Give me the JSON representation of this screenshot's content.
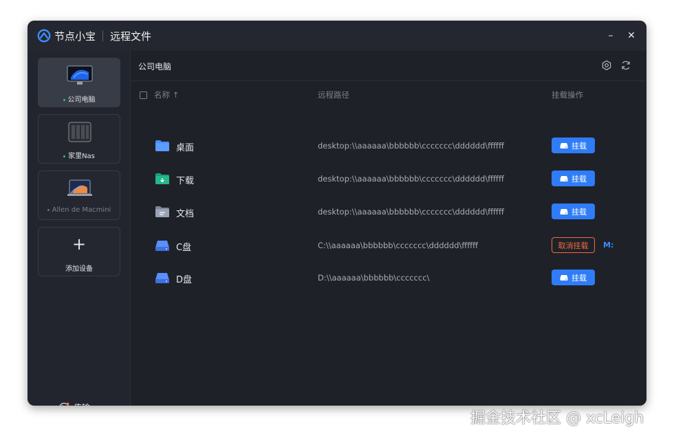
{
  "app": {
    "name": "节点小宝",
    "page": "远程文件"
  },
  "window_controls": {
    "minimize_glyph": "–",
    "close_glyph": "✕"
  },
  "sidebar": {
    "devices": [
      {
        "label": "公司电脑",
        "online": true,
        "active": true
      },
      {
        "label": "家里Nas",
        "online": true,
        "active": false
      },
      {
        "label": "Allen de Macmini",
        "online": false,
        "active": false
      }
    ],
    "add_device": {
      "plus": "+",
      "label": "添加设备"
    },
    "transfer": {
      "label": "传输"
    }
  },
  "main": {
    "title": "公司电脑",
    "columns": {
      "name": "名称 ↑",
      "path": "远程路径",
      "action": "挂载操作"
    },
    "rows": [
      {
        "name": "桌面",
        "icon": "folder-icon",
        "path": "desktop:\\\\aaaaaa\\bbbbbb\\ccccccc\\dddddd\\ffffff",
        "mounted": false,
        "action": "挂载"
      },
      {
        "name": "下载",
        "icon": "download-folder-icon",
        "path": "desktop:\\\\aaaaaa\\bbbbbb\\ccccccc\\dddddd\\ffffff",
        "mounted": false,
        "action": "挂载"
      },
      {
        "name": "文档",
        "icon": "document-folder-icon",
        "path": "desktop:\\\\aaaaaa\\bbbbbb\\ccccccc\\dddddd\\ffffff",
        "mounted": false,
        "action": "挂载"
      },
      {
        "name": "C盘",
        "icon": "drive-icon",
        "path": "C:\\\\aaaaaa\\bbbbbb\\ccccccc\\dddddd\\ffffff",
        "mounted": true,
        "action": "取消挂载",
        "drive_letter": "M:"
      },
      {
        "name": "D盘",
        "icon": "drive-icon",
        "path": "D:\\\\aaaaaa\\bbbbbb\\ccccccc\\",
        "mounted": false,
        "action": "挂载"
      }
    ]
  },
  "watermark": "掘金技术社区 @ xcLeigh",
  "colors": {
    "accent": "#2f7cf6",
    "danger": "#f26b3a",
    "online": "#27c96b",
    "background": "#1f2129"
  }
}
